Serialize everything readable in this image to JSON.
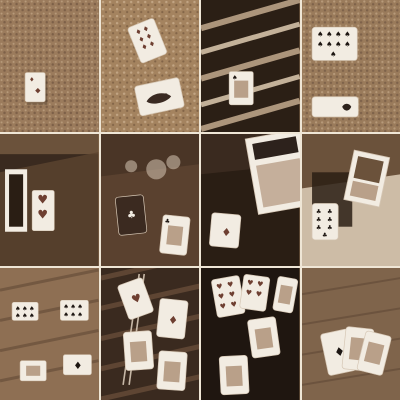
{
  "image": {
    "kind": "sepia photo collage",
    "layout": "4x3 grid of photos",
    "tiles": [
      {
        "name": "tile-carpet-single-card",
        "scene": "playing card on carpet"
      },
      {
        "name": "tile-carpet-two-cards",
        "scene": "cards on carpet"
      },
      {
        "name": "tile-striped-fabric-card",
        "scene": "playing card on striped fabric"
      },
      {
        "name": "tile-carpet-nine-spades",
        "scene": "cards on carpet"
      },
      {
        "name": "tile-mirror-table-card",
        "scene": "playing card by mirror"
      },
      {
        "name": "tile-glass-table-cards",
        "scene": "cards on glass table"
      },
      {
        "name": "tile-dark-table-book",
        "scene": "card and book on table"
      },
      {
        "name": "tile-clutter-clubs",
        "scene": "card among clutter"
      },
      {
        "name": "tile-wood-four-cards",
        "scene": "cards on wooden deck"
      },
      {
        "name": "tile-wood-chopsticks",
        "scene": "cards on wooden table"
      },
      {
        "name": "tile-dark-many-cards",
        "scene": "cards on dark table"
      },
      {
        "name": "tile-wood-fan-cards",
        "scene": "cards on wood floor"
      }
    ]
  },
  "palette": {
    "sepia_light": "#efe6d6",
    "sepia_mid": "#8a6d4f",
    "sepia_dark": "#2a1e14",
    "card": "#f2ece2",
    "ink": "#1d1612",
    "red": "#6e3f31"
  }
}
